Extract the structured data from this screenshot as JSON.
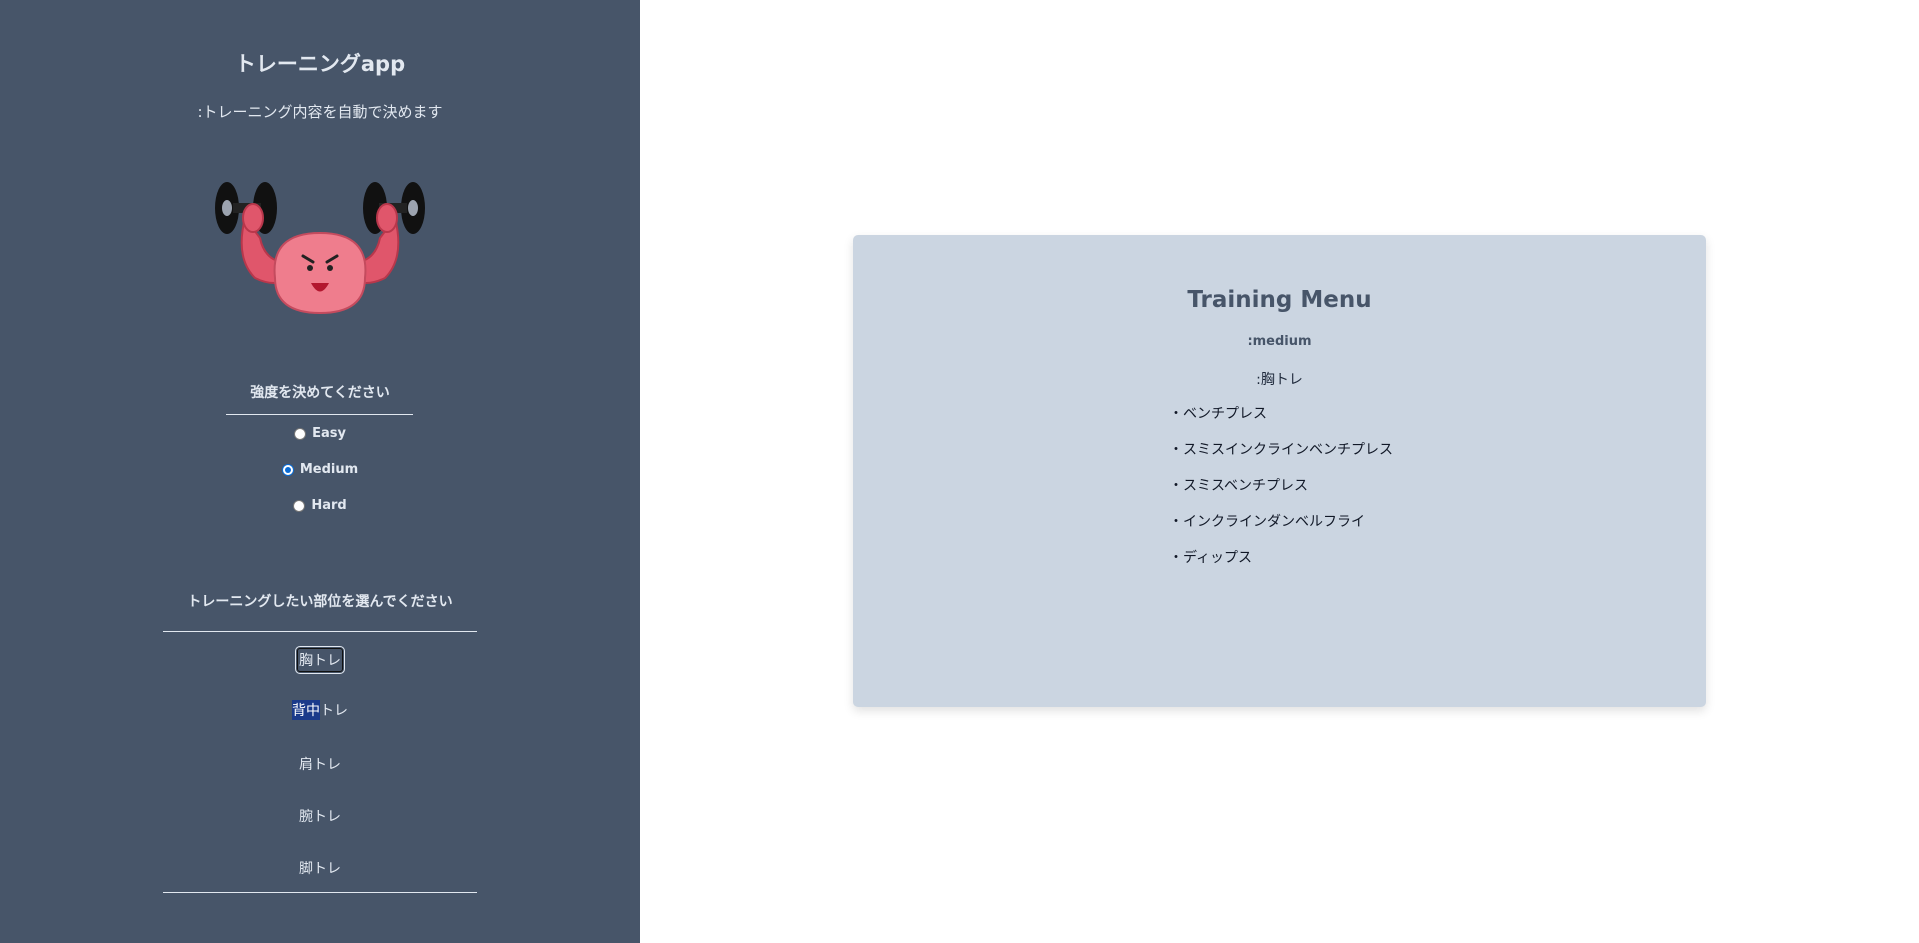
{
  "sidebar": {
    "title": "トレーニングapp",
    "subtitle": ":トレーニング内容を自動で決めます",
    "intensity_heading": "強度を決めてください",
    "intensity_options": [
      {
        "label": "Easy",
        "checked": false
      },
      {
        "label": "Medium",
        "checked": true
      },
      {
        "label": "Hard",
        "checked": false
      }
    ],
    "part_heading": "トレーニングしたい部位を選んでください",
    "parts": [
      {
        "label": "胸トレ"
      },
      {
        "label_selected": "背中",
        "label_rest": "トレ"
      },
      {
        "label": "肩トレ"
      },
      {
        "label": "腕トレ"
      },
      {
        "label": "脚トレ"
      }
    ]
  },
  "main": {
    "card": {
      "title": "Training Menu",
      "level": ":medium",
      "part": ":胸トレ",
      "exercises": [
        "・ベンチプレス",
        "・スミスインクラインベンチプレス",
        "・スミスベンチプレス",
        "・インクラインダンベルフライ",
        "・ディップス"
      ]
    }
  },
  "colors": {
    "sidebar_bg": "#475569",
    "card_bg": "#cbd5e1",
    "accent_radio": "#0b6bd3"
  }
}
